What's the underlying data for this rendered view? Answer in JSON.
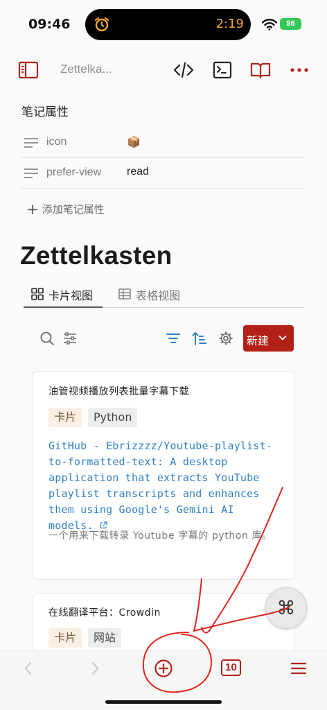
{
  "status": {
    "time": "09:46",
    "timer": "2:19",
    "battery": "96"
  },
  "toolbar": {
    "title": "Zettelka..."
  },
  "properties": {
    "heading": "笔记属性",
    "rows": [
      {
        "key": "icon",
        "value": "📦"
      },
      {
        "key": "prefer-view",
        "value": "read"
      }
    ],
    "add_label": "添加笔记属性"
  },
  "page": {
    "title": "Zettelkasten"
  },
  "views": {
    "card_label": "卡片视图",
    "table_label": "表格视图"
  },
  "controls": {
    "new_label": "新建"
  },
  "cards": [
    {
      "title": "油管视频播放列表批量字幕下载",
      "tags": [
        "卡片",
        "Python"
      ],
      "link": "GitHub - Ebrizzzz/Youtube-playlist-to-formatted-text: A desktop application that extracts YouTube playlist transcripts and enhances them using Google's Gemini AI models.",
      "description": "一个用来下载转录 Youtube 字幕的 python 库。"
    },
    {
      "title": "在线翻译平台：Crowdin",
      "tags": [
        "卡片",
        "网站"
      ]
    }
  ],
  "command_button": {
    "glyph": "⌘"
  },
  "bottom_bar": {
    "tab_count": "10"
  },
  "colors": {
    "accent": "#b22018",
    "link": "#2d7fc1",
    "annotation": "#e0231b"
  },
  "icons": [
    "alarm-icon",
    "wifi-icon",
    "sidebar-toggle-icon",
    "code-icon",
    "terminal-icon",
    "book-icon",
    "more-icon",
    "lines-icon",
    "plus-icon",
    "grid-icon",
    "table-icon",
    "search-icon",
    "sliders-icon",
    "filter-icon",
    "sort-icon",
    "gear-icon",
    "chevron-down-icon",
    "external-link-icon",
    "edit-icon",
    "back-icon",
    "forward-icon",
    "add-circle-icon",
    "menu-icon"
  ]
}
